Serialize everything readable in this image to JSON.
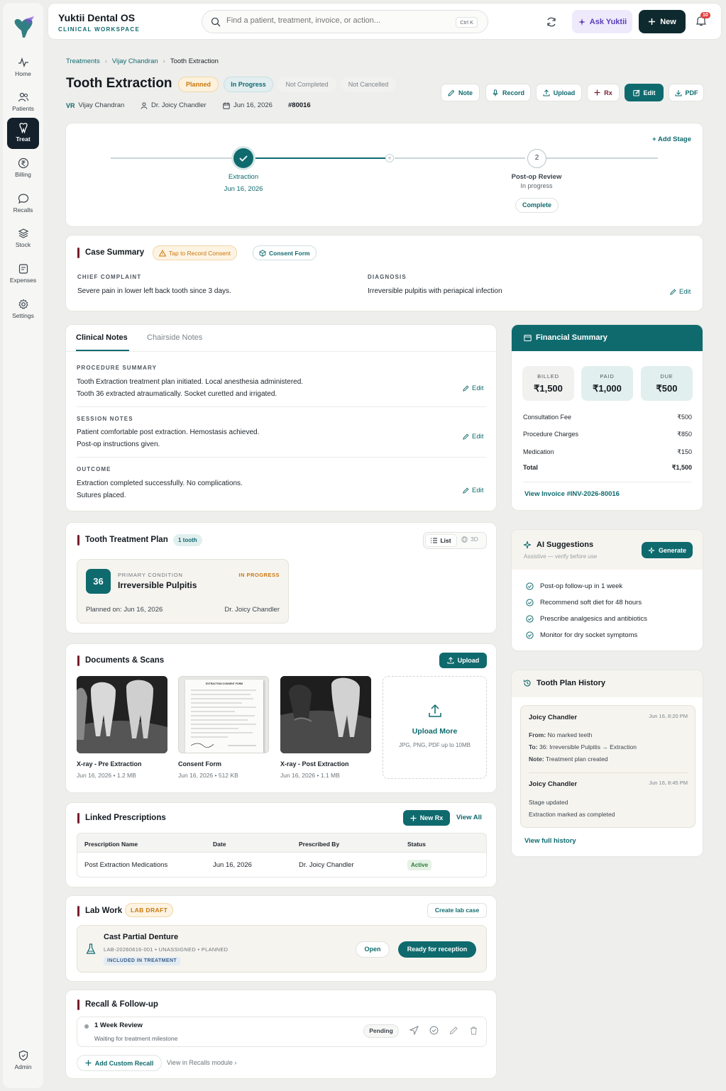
{
  "sidebar": {
    "items": [
      {
        "label": "Home",
        "icon": "pulse-icon"
      },
      {
        "label": "Patients",
        "icon": "users-icon"
      },
      {
        "label": "Treat",
        "icon": "tooth-icon"
      },
      {
        "label": "Billing",
        "icon": "rupee-icon"
      },
      {
        "label": "Recalls",
        "icon": "chat-icon"
      },
      {
        "label": "Stock",
        "icon": "layers-icon"
      },
      {
        "label": "Expenses",
        "icon": "receipt-icon"
      },
      {
        "label": "Settings",
        "icon": "gear-icon"
      }
    ],
    "admin": "Admin",
    "active": "Treat"
  },
  "header": {
    "brand_title": "Yuktii Dental OS",
    "brand_subtitle": "CLINICAL WORKSPACE",
    "search_placeholder": "Find a patient, treatment, invoice, or action...",
    "search_shortcut": "Ctrl K",
    "ask_label": "Ask Yuktii",
    "new_label": "New",
    "notification_count": "10"
  },
  "breadcrumb": [
    "Treatments",
    "Vijay Chandran",
    "Tooth Extraction"
  ],
  "page": {
    "title": "Tooth Extraction",
    "statuses": [
      "Planned",
      "In Progress",
      "Not Completed",
      "Not Cancelled"
    ],
    "patient": "Vijay Chandran",
    "patient_initials": "VR",
    "doctor": "Dr. Joicy Chandler",
    "date": "Jun 16, 2026",
    "case_id": "#80016",
    "actions": [
      "Note",
      "Record",
      "Upload",
      "Rx",
      "Edit",
      "PDF"
    ]
  },
  "stages": {
    "add_label": "Add Stage",
    "items": [
      {
        "name": "Extraction",
        "sub": "Jun 16, 2026",
        "state": "done"
      },
      {
        "name": "Post-op Review",
        "sub": "In progress",
        "number": "2",
        "state": "current",
        "button": "Complete"
      }
    ]
  },
  "case_summary": {
    "title": "Case Summary",
    "consent_tag": "Tap to Record Consent",
    "consent_form": "Consent Form",
    "chief_label": "CHIEF COMPLAINT",
    "chief_value": "Severe pain in lower left back tooth since 3 days.",
    "diagnosis_label": "DIAGNOSIS",
    "diagnosis_value": "Irreversible pulpitis with periapical infection",
    "edit_label": "Edit"
  },
  "notes": {
    "tabs": [
      "Clinical Notes",
      "Chairside Notes"
    ],
    "sections": [
      {
        "label": "PROCEDURE SUMMARY",
        "lines": [
          "Tooth Extraction treatment plan initiated. Local anesthesia administered.",
          "Tooth 36 extracted atraumatically. Socket curetted and irrigated."
        ]
      },
      {
        "label": "SESSION NOTES",
        "lines": [
          "Patient comfortable post extraction. Hemostasis achieved.",
          "Post-op instructions given."
        ]
      },
      {
        "label": "OUTCOME",
        "lines": [
          "Extraction completed successfully. No complications.",
          "Sutures placed."
        ]
      }
    ],
    "edit_label": "Edit"
  },
  "financial": {
    "title": "Financial Summary",
    "billed_label": "BILLED",
    "billed": "₹1,500",
    "paid_label": "PAID",
    "paid": "₹1,000",
    "due_label": "DUE",
    "due": "₹500",
    "rows": [
      {
        "name": "Consultation Fee",
        "value": "₹500"
      },
      {
        "name": "Procedure Charges",
        "value": "₹850"
      },
      {
        "name": "Medication",
        "value": "₹150"
      },
      {
        "name": "Total",
        "value": "₹1,500"
      }
    ],
    "invoice_link": "View Invoice #INV-2026-80016"
  },
  "treatment_plan": {
    "title": "Tooth Treatment Plan",
    "count_badge": "1 tooth",
    "view_list": "List",
    "view_3d": "3D",
    "tooth_number": "36",
    "condition_label": "PRIMARY CONDITION",
    "condition": "Irreversible Pulpitis",
    "status": "IN PROGRESS",
    "planned_on": "Planned on: Jun 16, 2026",
    "doctor": "Dr. Joicy Chandler"
  },
  "ai": {
    "title": "AI Suggestions",
    "subtitle": "Assistive — verify before use",
    "generate": "Generate",
    "items": [
      "Post-op follow-up in 1 week",
      "Recommend soft diet for 48 hours",
      "Prescribe analgesics and antibiotics",
      "Monitor for dry socket symptoms"
    ]
  },
  "documents": {
    "title": "Documents & Scans",
    "upload": "Upload",
    "items": [
      {
        "name": "X-ray - Pre Extraction",
        "meta": "Jun 16, 2026 • 1.2 MB"
      },
      {
        "name": "Consent Form",
        "meta": "Jun 16, 2026 • 512 KB"
      },
      {
        "name": "X-ray - Post Extraction",
        "meta": "Jun 16, 2026 • 1.1 MB"
      }
    ],
    "upload_more": "Upload More",
    "upload_hint": "JPG, PNG, PDF up to 10MB",
    "consent_doc_heading": "EXTRACTION CONSENT FORM"
  },
  "history": {
    "title": "Tooth Plan History",
    "entries": [
      {
        "user": "Joicy Chandler",
        "time": "Jun 16, 8:20 PM",
        "from_label": "From:",
        "from": "No marked teeth",
        "to_label": "To:",
        "to": "36: Irreversible Pulpitis → Extraction",
        "note_label": "Note:",
        "note": "Treatment plan created"
      },
      {
        "user": "Joicy Chandler",
        "time": "Jun 16, 8:45 PM",
        "line1": "Stage updated",
        "line2": "Extraction marked as completed"
      }
    ],
    "link": "View full history"
  },
  "prescriptions": {
    "title": "Linked Prescriptions",
    "new_rx": "New Rx",
    "view_all": "View All",
    "columns": [
      "Prescription Name",
      "Date",
      "Prescribed By",
      "Status"
    ],
    "rows": [
      {
        "name": "Post Extraction Medications",
        "date": "Jun 16, 2026",
        "by": "Dr. Joicy Chandler",
        "status": "Active"
      }
    ]
  },
  "lab": {
    "title": "Lab Work",
    "badge": "LAB DRAFT",
    "create": "Create lab case",
    "item_title": "Cast Partial Denture",
    "item_meta": "LAB-20260616-001 • UNASSIGNED • PLANNED",
    "item_badge": "INCLUDED IN TREATMENT",
    "open": "Open",
    "ready": "Ready for reception"
  },
  "recall": {
    "title": "Recall & Follow-up",
    "item_title": "1 Week Review",
    "item_sub": "Waiting for treatment milestone",
    "status": "Pending",
    "add": "Add Custom Recall",
    "view_module": "View in Recalls module"
  },
  "colors": {
    "teal": "#0f6a6e",
    "dark": "#0f2a2f",
    "accent": "#7a1d2e",
    "planned": "#c9780f"
  }
}
